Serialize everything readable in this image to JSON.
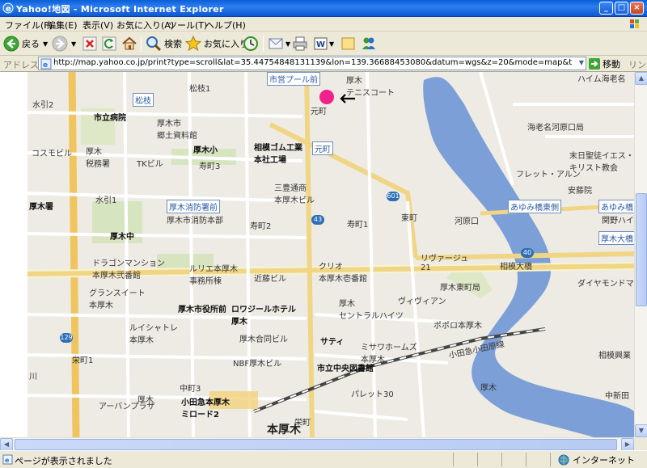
{
  "window": {
    "title": "Yahoo!地図 - Microsoft Internet Explorer"
  },
  "menu": [
    "ファイル(F)",
    "編集(E)",
    "表示(V)",
    "お気に入り(A)",
    "ツール(T)",
    "ヘルプ(H)"
  ],
  "toolbar": {
    "back": "戻る",
    "search": "検索",
    "favorites": "お気に入り"
  },
  "address": {
    "label": "アドレス(D)",
    "url": "http://map.yahoo.co.jp/print?type=scroll&lat=35.44754848131139&lon=139.36688453080&datum=wgs&z=20&mode=map&type=scroll&pointer=off&home=on&hlat=35.",
    "go": "移動",
    "links": "リンク"
  },
  "status": {
    "text": "ページが表示されました",
    "zone": "インターネット"
  },
  "map": {
    "labels": {
      "mizuhiki2": "水引2",
      "shiritsu_byoin": "市立病院",
      "matsumi": "松枝",
      "matsugi1": "松枝1",
      "atsugi_kyodo": "厚木市\n郷土資料館",
      "atsugi_sho": "厚木小",
      "atsugi_zeimusho": "厚木\n税務署",
      "cosmo": "コスモビル",
      "tk": "TKビル",
      "kotobuki3": "寿町3",
      "sagami_gomu": "相模ゴム工業\n本社工場",
      "motomachi": "元町",
      "motomachi2": "元町",
      "mizuhiki1": "水引1",
      "atsugisho": "厚木署",
      "shobo_mae": "厚木消防署前",
      "shobo_honbu": "厚木市消防本部",
      "mitsubishi": "三豊通商\n本厚木ビル",
      "kotobuki2": "寿町2",
      "kotobuki1": "寿町1",
      "higashimachi": "東町",
      "kawarakuchi": "河原口",
      "atsugi_chu": "厚木中",
      "dragon": "ドラゴンマンション\n本厚木弐番館",
      "lulu": "ルリエ本厚木\n事務所棟",
      "kondo": "近藤ビル",
      "clio": "クリオ\n本厚木壱番館",
      "revage": "リヴァージュ\n21",
      "sagami_ohashi": "相模大橋",
      "higashi_post": "厚木東町局",
      "grand": "グランスイート\n本厚木",
      "shiyakusho": "厚木市役所前",
      "rosier": "ロワジールホテル\n厚木",
      "central": "厚木\nセントラルハイツ",
      "vivian": "ヴィヴィアン",
      "polo": "ポポロ本厚木",
      "luisharay": "ルイシャトレ\n本厚木",
      "goudou": "厚木合同ビル",
      "saty": "サティ",
      "misawa": "ミサワホームズ\n本厚木",
      "nbf": "NBF厚木ビル",
      "sakae1": "栄町1",
      "kawa": "川",
      "library": "市立中央図書館",
      "odakyu": "小田急小田原線",
      "naka3": "中町3",
      "urban": "アーバンプラザ",
      "atsugi_k": "厚木",
      "miroad": "小田急本厚木\nミロード2",
      "pallet": "パレット30",
      "sakae2": "栄町",
      "station": "本厚木",
      "shinden": "中新田",
      "ebina_post": "海老名河原口局",
      "suehiro": "末日聖徒イエス・\nキリスト教会",
      "fret": "フレット・アルン",
      "shinanmachi": "安藤院",
      "ayumi_higashi": "あゆみ橋東側",
      "ayumi": "あゆみ橋",
      "sekiya": "関野ハイツ",
      "atsugi_ohashi": "厚木大橋",
      "diamond": "ダイヤモンドマ",
      "atsugi_kogyo": "相模興業",
      "atsugi_cho": "厚木",
      "teniscourt": "厚木\nテニスコート",
      "ichiba_pool": "市営プール前",
      "hoimi": "ハイム海老名"
    },
    "route_numbers": [
      "43",
      "601",
      "40",
      "129"
    ]
  }
}
